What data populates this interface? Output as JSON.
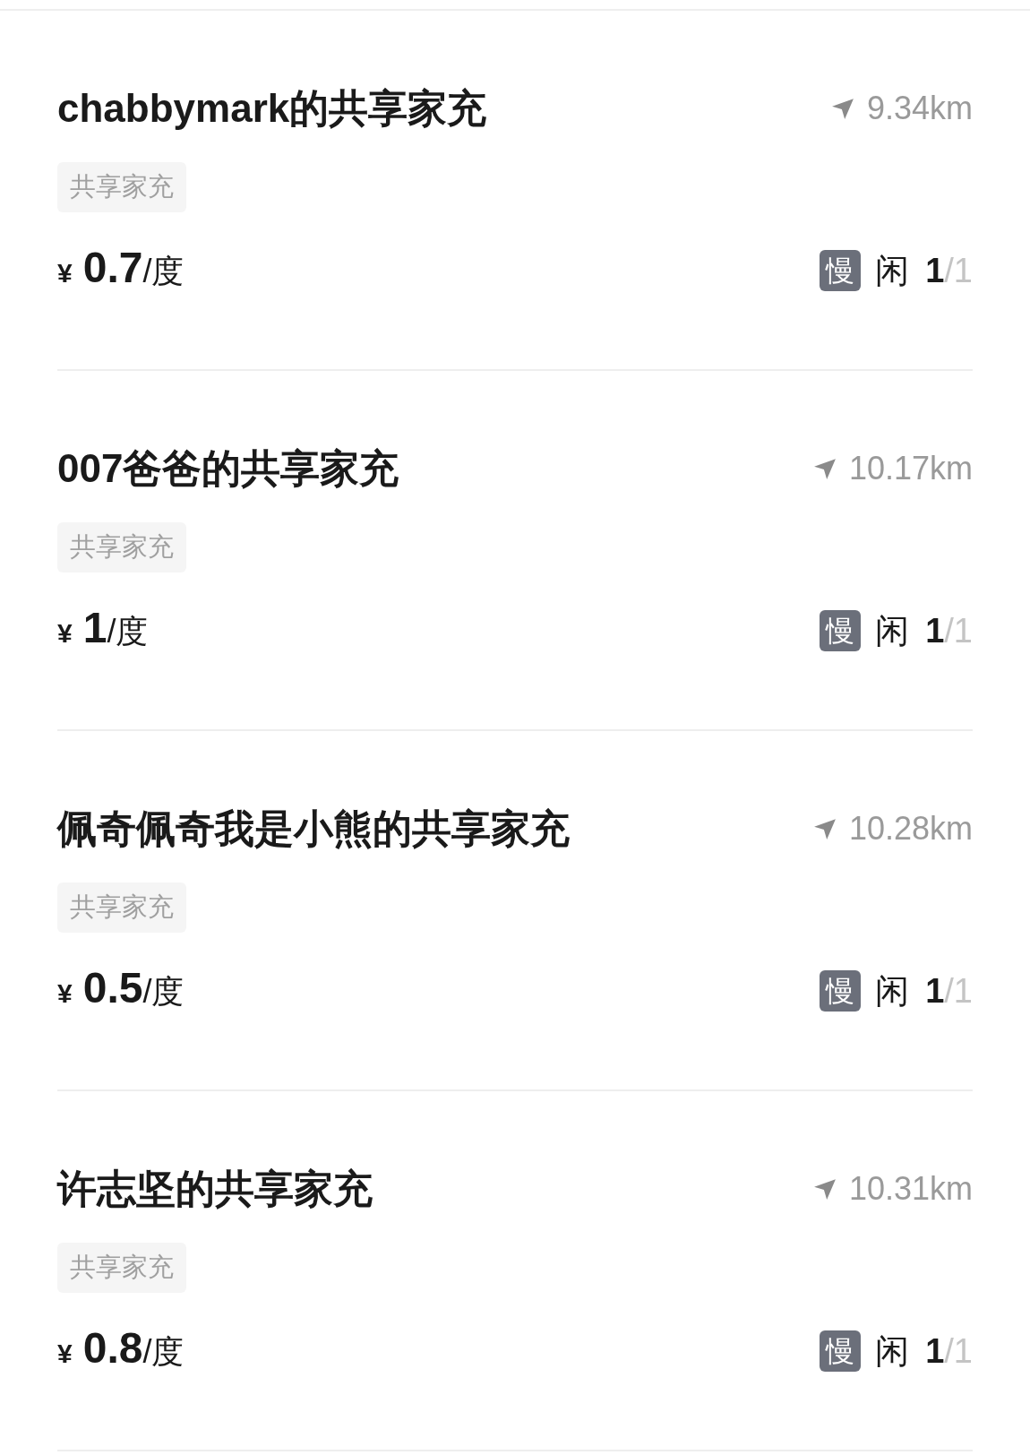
{
  "stations": [
    {
      "name": "chabbymark的共享家充",
      "distance": "9.34km",
      "tag": "共享家充",
      "currency": "¥",
      "price": "0.7",
      "unit": "/度",
      "speed": "慢",
      "status": "闲",
      "available": "1",
      "total": "/1"
    },
    {
      "name": "007爸爸的共享家充",
      "distance": "10.17km",
      "tag": "共享家充",
      "currency": "¥",
      "price": "1",
      "unit": "/度",
      "speed": "慢",
      "status": "闲",
      "available": "1",
      "total": "/1"
    },
    {
      "name": "佩奇佩奇我是小熊的共享家充",
      "distance": "10.28km",
      "tag": "共享家充",
      "currency": "¥",
      "price": "0.5",
      "unit": "/度",
      "speed": "慢",
      "status": "闲",
      "available": "1",
      "total": "/1"
    },
    {
      "name": "许志坚的共享家充",
      "distance": "10.31km",
      "tag": "共享家充",
      "currency": "¥",
      "price": "0.8",
      "unit": "/度",
      "speed": "慢",
      "status": "闲",
      "available": "1",
      "total": "/1"
    }
  ]
}
